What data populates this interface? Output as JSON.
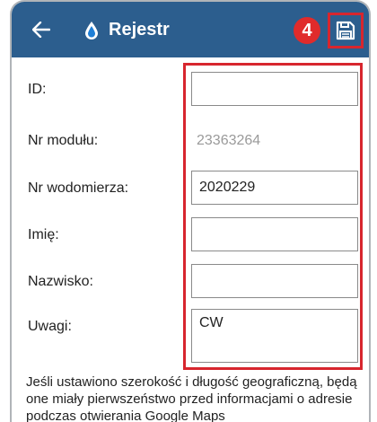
{
  "header": {
    "title": "Rejestr",
    "badge": "4",
    "background_color": "#2c5e8e"
  },
  "form": {
    "rows": [
      {
        "label": "ID:",
        "value": ""
      },
      {
        "label": "Nr modułu:",
        "value": "23363264"
      },
      {
        "label": "Nr wodomierza:",
        "value": "2020229"
      },
      {
        "label": "Imię:",
        "value": ""
      },
      {
        "label": "Nazwisko:",
        "value": ""
      },
      {
        "label": "Uwagi:",
        "value": "CW"
      }
    ]
  },
  "note": "Jeśli ustawiono szerokość i długość geograficzną, będą one miały pierwszeństwo przed informacjami o adresie podczas otwierania Google Maps",
  "colors": {
    "highlight": "#d7262e",
    "badge": "#e02b2b"
  },
  "icons": {
    "back": "arrow-left-icon",
    "logo": "water-drop-icon",
    "save": "floppy-disk-icon"
  }
}
